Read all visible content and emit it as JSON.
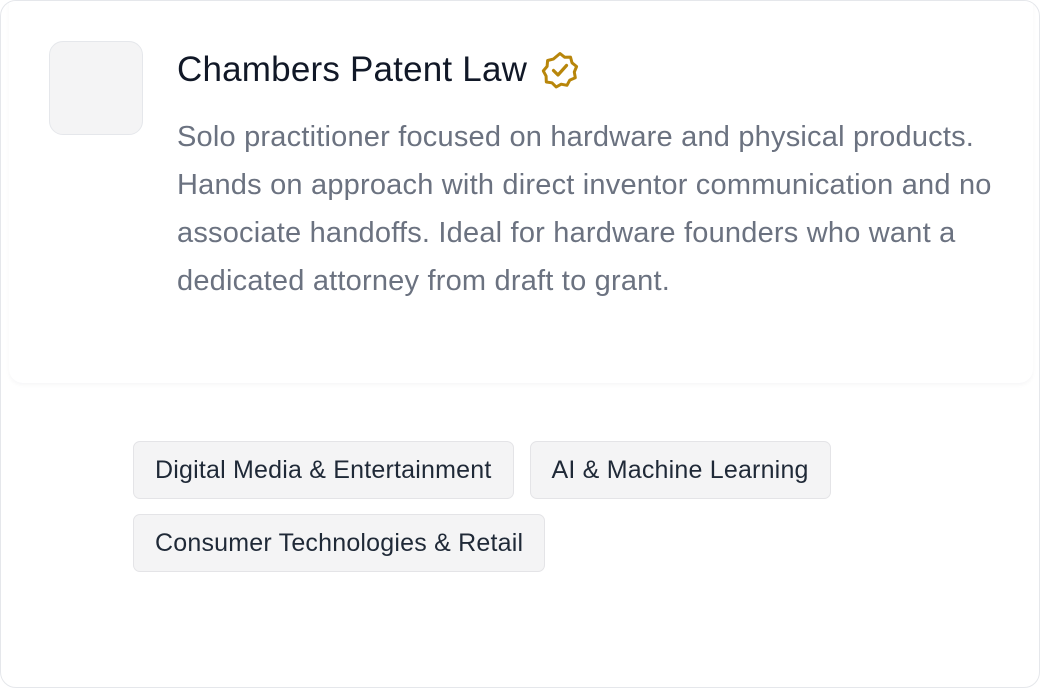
{
  "firm": {
    "name": "Chambers Patent Law",
    "verified_icon": "verified-badge-icon",
    "description": "Solo practitioner focused on hardware and physical products. Hands on approach with direct inventor communication and no associate handoffs. Ideal for hardware founders who want a dedicated attorney from draft to grant."
  },
  "tags": [
    {
      "label": "Digital Media & Entertainment"
    },
    {
      "label": "AI & Machine Learning"
    },
    {
      "label": "Consumer Technologies & Retail"
    }
  ],
  "colors": {
    "verified_badge": "#b8860b",
    "title": "#111827",
    "description": "#6b7280",
    "tag_background": "#f4f4f5",
    "tag_border": "#e4e4e7"
  }
}
